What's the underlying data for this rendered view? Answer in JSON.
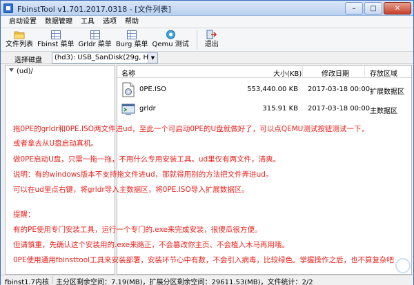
{
  "window": {
    "title": "FbinstTool v1.701.2017.0318 - [文件列表]",
    "controls": {
      "minimize": "–",
      "maximize": "□",
      "close": "✕"
    }
  },
  "menu": {
    "items": [
      {
        "label": "启动设置"
      },
      {
        "label": "数据管理"
      },
      {
        "label": "工具"
      },
      {
        "label": "选项"
      },
      {
        "label": "帮助"
      }
    ]
  },
  "toolbar": {
    "buttons": [
      {
        "label": "文件列表",
        "icon": "folder-icon"
      },
      {
        "label": "Fbinst 菜单",
        "icon": "grid-icon"
      },
      {
        "label": "Grldr 菜单",
        "icon": "grid-icon"
      },
      {
        "label": "Burg 菜单",
        "icon": "grid-icon"
      },
      {
        "label": "Qemu 测试",
        "icon": "qemu-icon"
      },
      {
        "label": "退出",
        "icon": "exit-icon"
      }
    ]
  },
  "disk": {
    "label": "选择磁盘",
    "selected": "(hd3): USB_SanDisk(29g, H:)"
  },
  "tree": {
    "root": "(ud)/"
  },
  "file_list": {
    "columns": {
      "name": "名称",
      "size": "大小(KB)",
      "modified": "修改日期",
      "area": "存放区域"
    },
    "rows": [
      {
        "name": "0PE.ISO",
        "size": "553,440.00 KB",
        "modified": "2017-03-18 00:00",
        "area": "扩展数据区",
        "icon": "iso-file-icon"
      },
      {
        "name": "grldr",
        "size": "315.91 KB",
        "modified": "2017-03-18 00:00",
        "area": "主数据区",
        "icon": "program-file-icon"
      }
    ]
  },
  "notes": [
    "拖0PE的grldr和0PE.ISO两文件进ud，至此一个可启动0PE的U盘就做好了，可以点QEMU测试按钮测试一下，",
    "或者拿去从U盘启动真机。",
    "做0PE启动U盘，只需一拖一拖，不用什么专用安装工具。ud里仅有两文件，清爽。",
    "说明：有的windows版本不支持拖文件进ud，那就得用别的方法把文件弄进ud。",
    "可以在ud里点右键，将grldr导入主数据区，将0PE.ISO导入扩展数据区。",
    "提醒：",
    "有的PE使用专门安装工具，运行一个专门的.exe来完成安装，很傻瓜很方便。",
    "但请慎重，先确认这个安装用的.exe来路正，不会篡改你主页、不会植入木马再用哦。",
    "0PE使用通用fbinsttool工具来安装部署，安装环节心中有数，不会引入病毒，比较绿色。掌握操作之后，也不算复杂吧"
  ],
  "status": {
    "version": "fbinst1.7内核",
    "primary": "主分区剩余空间：7.19(MB)，扩展分区剩余空间：29611.53(MB)，文件统计：2/2"
  },
  "colors": {
    "note_red": "#e8231e",
    "title_blue": "#b9d1ef",
    "border_blue": "#3c6cbf"
  }
}
